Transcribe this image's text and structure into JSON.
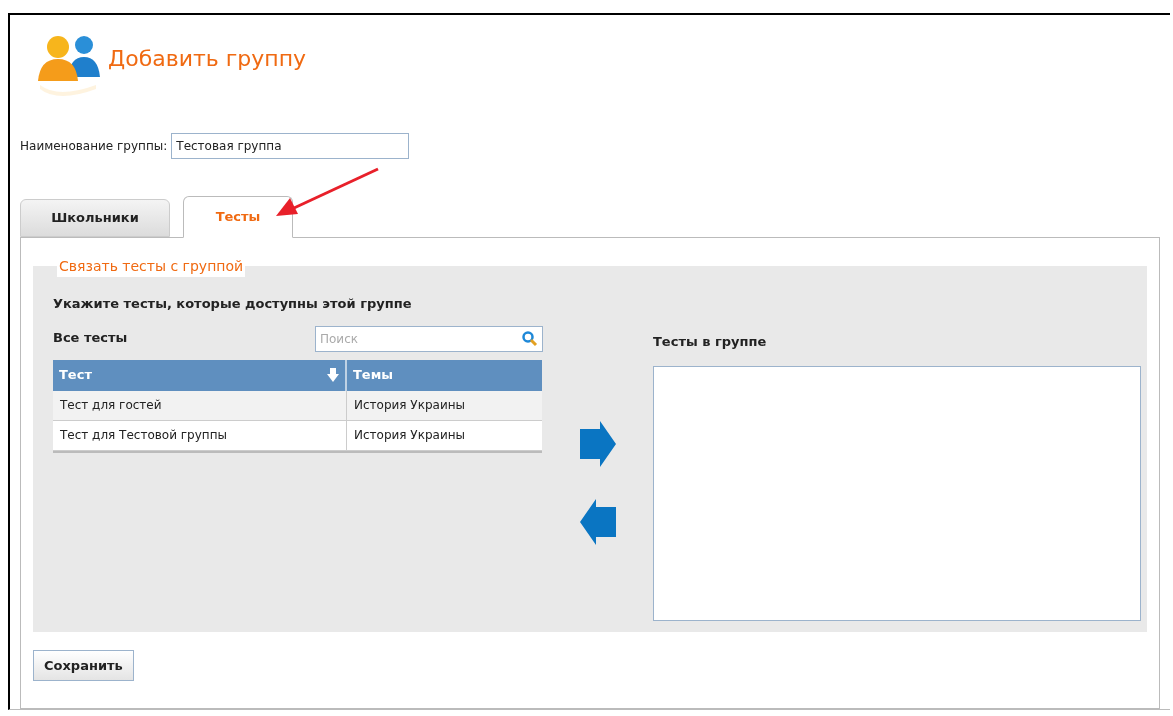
{
  "page": {
    "title": "Добавить группу"
  },
  "group_name": {
    "label": "Наименование группы:",
    "value": "Тестовая группа"
  },
  "tabs": [
    {
      "label": "Школьники",
      "selected": false
    },
    {
      "label": "Тесты",
      "selected": true
    }
  ],
  "fieldset": {
    "legend": "Связать тесты с группой",
    "instruction": "Укажите тесты, которые доступны этой группе",
    "all_tests": {
      "heading": "Все тесты",
      "search": {
        "placeholder": "Поиск"
      },
      "columns": [
        {
          "label": "Тест",
          "sorted": true
        },
        {
          "label": "Темы",
          "sorted": false
        }
      ],
      "rows": [
        [
          "Тест для гостей",
          "История Украины"
        ],
        [
          "Тест для Тестовой группы",
          "История Украины"
        ]
      ]
    },
    "group_tests": {
      "heading": "Тесты в группе"
    }
  },
  "buttons": [
    "Сохранить"
  ]
}
